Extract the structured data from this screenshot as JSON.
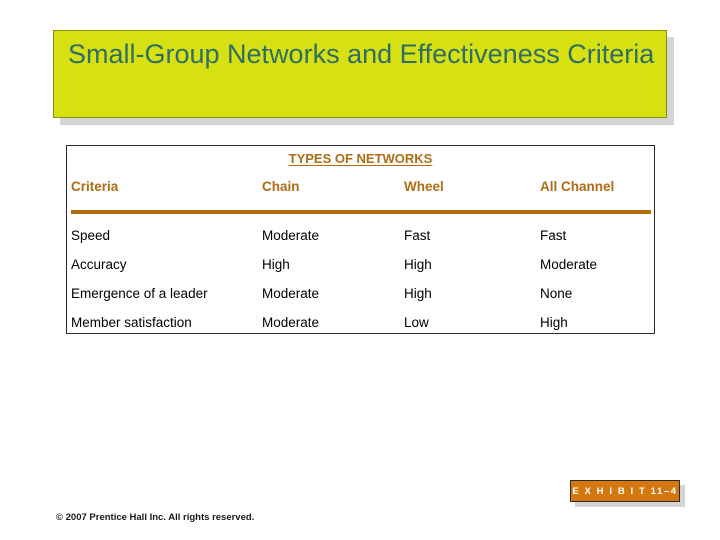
{
  "slide": {
    "title": "Small-Group Networks and Effectiveness Criteria",
    "background_color": "#ffffff",
    "title_banner_color": "#d7e010",
    "title_text_color": "#2f6f63",
    "accent_color": "#b06c14",
    "badge_color": "#d4770d"
  },
  "table": {
    "group_header": "TYPES OF NETWORKS",
    "columns": [
      "Criteria",
      "Chain",
      "Wheel",
      "All Channel"
    ],
    "rows": [
      {
        "criteria": "Speed",
        "chain": "Moderate",
        "wheel": "Fast",
        "all_channel": "Fast"
      },
      {
        "criteria": "Accuracy",
        "chain": "High",
        "wheel": "High",
        "all_channel": "Moderate"
      },
      {
        "criteria": "Emergence of a leader",
        "chain": "Moderate",
        "wheel": "High",
        "all_channel": "None"
      },
      {
        "criteria": "Member satisfaction",
        "chain": "Moderate",
        "wheel": "Low",
        "all_channel": "High"
      }
    ]
  },
  "footer": {
    "exhibit_label": "E X H I B I T 11–4",
    "copyright": "© 2007 Prentice Hall Inc. All rights reserved."
  }
}
